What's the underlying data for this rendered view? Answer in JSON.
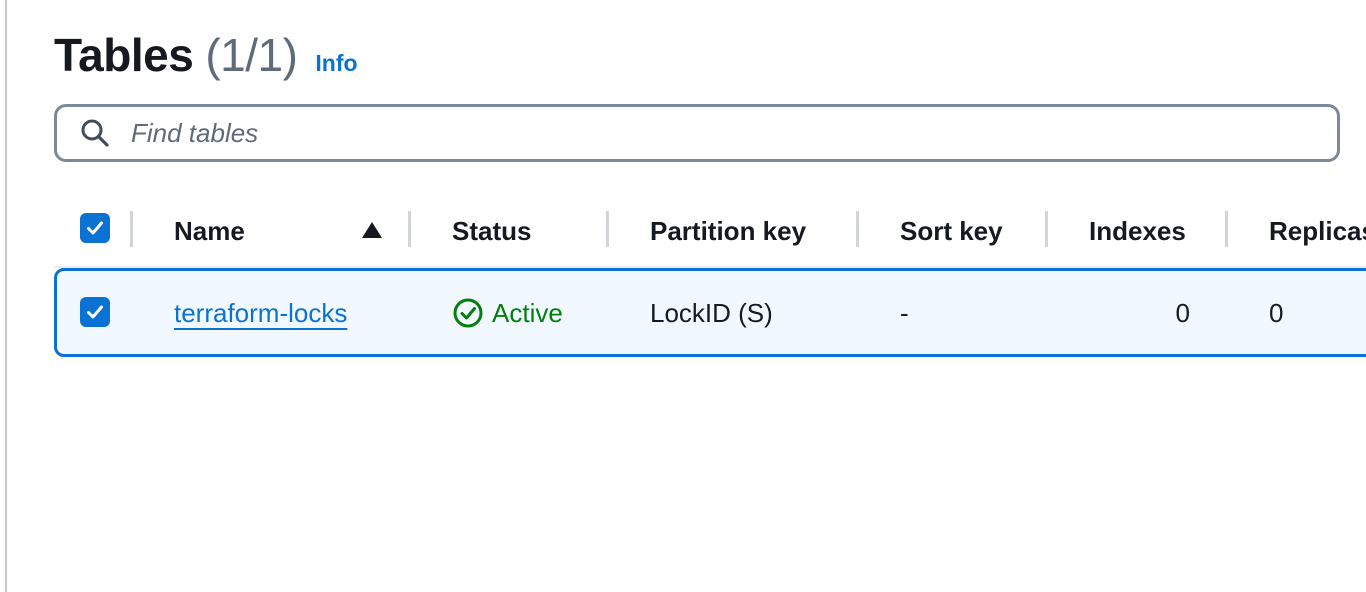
{
  "header": {
    "title": "Tables",
    "count": "(1/1)",
    "info_label": "Info"
  },
  "search": {
    "placeholder": "Find tables",
    "value": ""
  },
  "table": {
    "columns": {
      "name": "Name",
      "status": "Status",
      "partition_key": "Partition key",
      "sort_key": "Sort key",
      "indexes": "Indexes",
      "replicas": "Replicas"
    },
    "sort": {
      "column": "Name",
      "direction": "ascending"
    },
    "select_all_checked": true,
    "rows": [
      {
        "selected": true,
        "name": "terraform-locks",
        "status": "Active",
        "partition_key": "LockID (S)",
        "sort_key": "-",
        "indexes": "0",
        "replicas": "0"
      }
    ]
  },
  "colors": {
    "accent": "#0972d3",
    "success": "#037f0c",
    "row_selected_bg": "#f1f8ff"
  },
  "icons": {
    "search": "search-icon",
    "sort": "sort-ascending-icon",
    "status": "check-circle-icon",
    "checkbox": "checkmark-icon"
  }
}
